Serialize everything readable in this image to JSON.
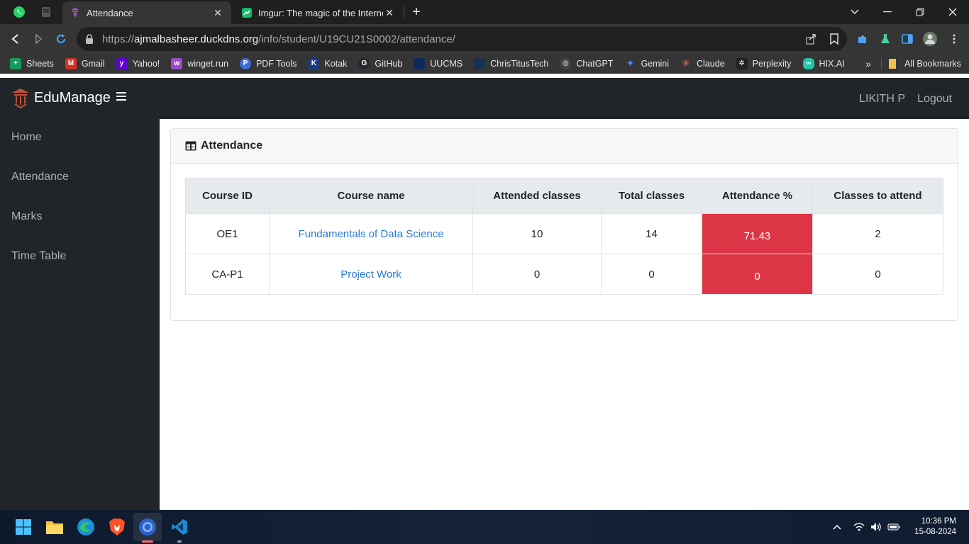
{
  "browser": {
    "tabs": [
      {
        "title": "Attendance",
        "active": true
      },
      {
        "title": "Imgur: The magic of the Internet",
        "active": false
      }
    ],
    "url": {
      "scheme": "https://",
      "host": "ajmalbasheer.duckdns.org",
      "path": "/info/student/U19CU21S0002/attendance/"
    },
    "bookmarks": [
      {
        "label": "Sheets",
        "icon": "sheets-icon",
        "color": "#0f9d58"
      },
      {
        "label": "Gmail",
        "icon": "gmail-icon",
        "color": "#d93025"
      },
      {
        "label": "Yahoo!",
        "icon": "yahoo-icon",
        "color": "#6001d2"
      },
      {
        "label": "winget.run",
        "icon": "winget-icon",
        "color": "#9b4dca"
      },
      {
        "label": "PDF Tools",
        "icon": "pdf-tools-icon",
        "color": "#3d6be0"
      },
      {
        "label": "Kotak",
        "icon": "kotak-icon",
        "color": "#1d3a7a"
      },
      {
        "label": "GitHub",
        "icon": "github-icon",
        "color": "#24292f"
      },
      {
        "label": "UUCMS",
        "icon": "uucms-icon",
        "color": "#0b2a5b"
      },
      {
        "label": "ChrisTitusTech",
        "icon": "christitustech-icon",
        "color": "#1a3050"
      },
      {
        "label": "ChatGPT",
        "icon": "chatgpt-icon",
        "color": "#444444"
      },
      {
        "label": "Gemini",
        "icon": "gemini-icon",
        "color": "#4f86f7"
      },
      {
        "label": "Claude",
        "icon": "claude-icon",
        "color": "#d97757"
      },
      {
        "label": "Perplexity",
        "icon": "perplexity-icon",
        "color": "#222222"
      },
      {
        "label": "HIX.AI",
        "icon": "hixai-icon",
        "color": "#1fc7a5"
      }
    ],
    "all_bookmarks": "All Bookmarks",
    "more": "»"
  },
  "app": {
    "brand": "EduManage",
    "user": "LIKITH P",
    "logout": "Logout",
    "sidebar": [
      {
        "label": "Home"
      },
      {
        "label": "Attendance"
      },
      {
        "label": "Marks"
      },
      {
        "label": "Time Table"
      }
    ],
    "card_title": "Attendance",
    "table": {
      "headers": [
        "Course ID",
        "Course name",
        "Attended classes",
        "Total classes",
        "Attendance %",
        "Classes to attend"
      ],
      "rows": [
        {
          "course_id": "OE1",
          "course_name": "Fundamentals of Data Science",
          "attended": "10",
          "total": "14",
          "percent": "71.43",
          "to_attend": "2"
        },
        {
          "course_id": "CA-P1",
          "course_name": "Project Work",
          "attended": "0",
          "total": "0",
          "percent": "0",
          "to_attend": "0"
        }
      ]
    },
    "colors": {
      "danger": "#dc3545",
      "link": "#2a7ad8",
      "sidebar_bg": "#212529"
    }
  },
  "taskbar": {
    "time": "10:36 PM",
    "date": "15-08-2024"
  }
}
